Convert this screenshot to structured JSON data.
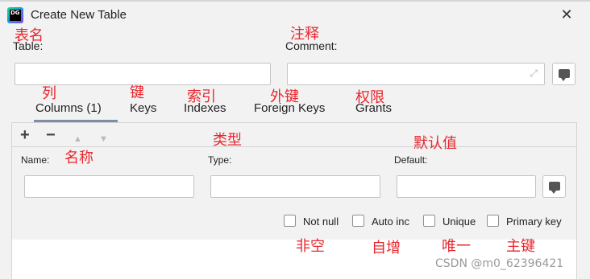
{
  "window": {
    "title": "Create New Table",
    "logo_text": "DG",
    "close_symbol": "✕"
  },
  "annotations": {
    "table": "表名",
    "comment": "注释",
    "columns": "列",
    "keys": "键",
    "indexes": "索引",
    "foreign_keys": "外键",
    "grants": "权限",
    "type": "类型",
    "name": "名称",
    "default": "默认值",
    "not_null": "非空",
    "auto_inc": "自增",
    "unique": "唯一",
    "primary_key": "主键"
  },
  "form": {
    "table_label": "Table:",
    "table_value": "",
    "comment_label": "Comment:",
    "comment_value": ""
  },
  "tabs": [
    {
      "label": "Columns (1)",
      "active": true
    },
    {
      "label": "Keys",
      "active": false
    },
    {
      "label": "Indexes",
      "active": false
    },
    {
      "label": "Foreign Keys",
      "active": false
    },
    {
      "label": "Grants",
      "active": false
    }
  ],
  "toolbar": {
    "add": "+",
    "remove": "−",
    "up": "▲",
    "down": "▼"
  },
  "column_form": {
    "name_label": "Name:",
    "name_value": "",
    "type_label": "Type:",
    "type_value": "",
    "default_label": "Default:",
    "default_value": ""
  },
  "checkboxes": {
    "not_null": {
      "label": "Not null",
      "checked": false
    },
    "auto_inc": {
      "label": "Auto inc",
      "checked": false
    },
    "unique": {
      "label": "Unique",
      "checked": false
    },
    "primary_key": {
      "label": "Primary key",
      "checked": false
    }
  },
  "watermark": "CSDN @m0_62396421",
  "colors": {
    "annotation": "#e8262e",
    "tab_underline": "#7d8ea8",
    "background": "#f2f2f2"
  }
}
